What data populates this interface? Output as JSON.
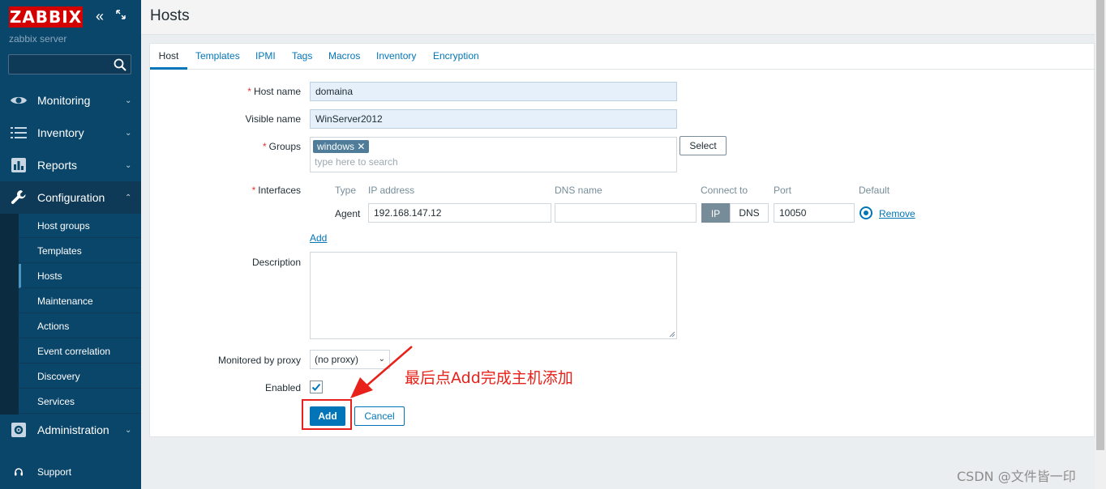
{
  "sidebar": {
    "logo": "ZABBIX",
    "collapse_icon": "double-chevron-left-icon",
    "server_name": "zabbix server",
    "menu": [
      {
        "label": "Monitoring",
        "icon": "eye-icon"
      },
      {
        "label": "Inventory",
        "icon": "list-icon"
      },
      {
        "label": "Reports",
        "icon": "bar-chart-icon"
      },
      {
        "label": "Configuration",
        "icon": "wrench-icon"
      },
      {
        "label": "Administration",
        "icon": "gear-icon"
      }
    ],
    "submenu": [
      "Host groups",
      "Templates",
      "Hosts",
      "Maintenance",
      "Actions",
      "Event correlation",
      "Discovery",
      "Services"
    ],
    "active_submenu": "Hosts",
    "support_label": "Support"
  },
  "header": {
    "title": "Hosts"
  },
  "tabs": [
    "Host",
    "Templates",
    "IPMI",
    "Tags",
    "Macros",
    "Inventory",
    "Encryption"
  ],
  "active_tab": "Host",
  "form": {
    "host_name_label": "Host name",
    "host_name_value": "domaina",
    "visible_name_label": "Visible name",
    "visible_name_value": "WinServer2012",
    "groups_label": "Groups",
    "group_tag": "windows",
    "groups_placeholder": "type here to search",
    "select_label": "Select",
    "interfaces_label": "Interfaces",
    "columns": [
      "Type",
      "IP address",
      "DNS name",
      "Connect to",
      "Port",
      "Default"
    ],
    "interface": {
      "type": "Agent",
      "ip": "192.168.147.12",
      "dns": "",
      "connect_ip": "IP",
      "connect_dns": "DNS",
      "port": "10050",
      "remove": "Remove"
    },
    "add_interface": "Add",
    "description_label": "Description",
    "proxy_label": "Monitored by proxy",
    "proxy_value": "(no proxy)",
    "enabled_label": "Enabled",
    "add_button": "Add",
    "cancel_button": "Cancel"
  },
  "annotation": "最后点Add完成主机添加",
  "watermark": "CSDN @文件皆一印",
  "colors": {
    "sidebar": "#0a466a",
    "accent": "#0275b8",
    "logo_red": "#d40000",
    "annotation_red": "#e8221a"
  }
}
